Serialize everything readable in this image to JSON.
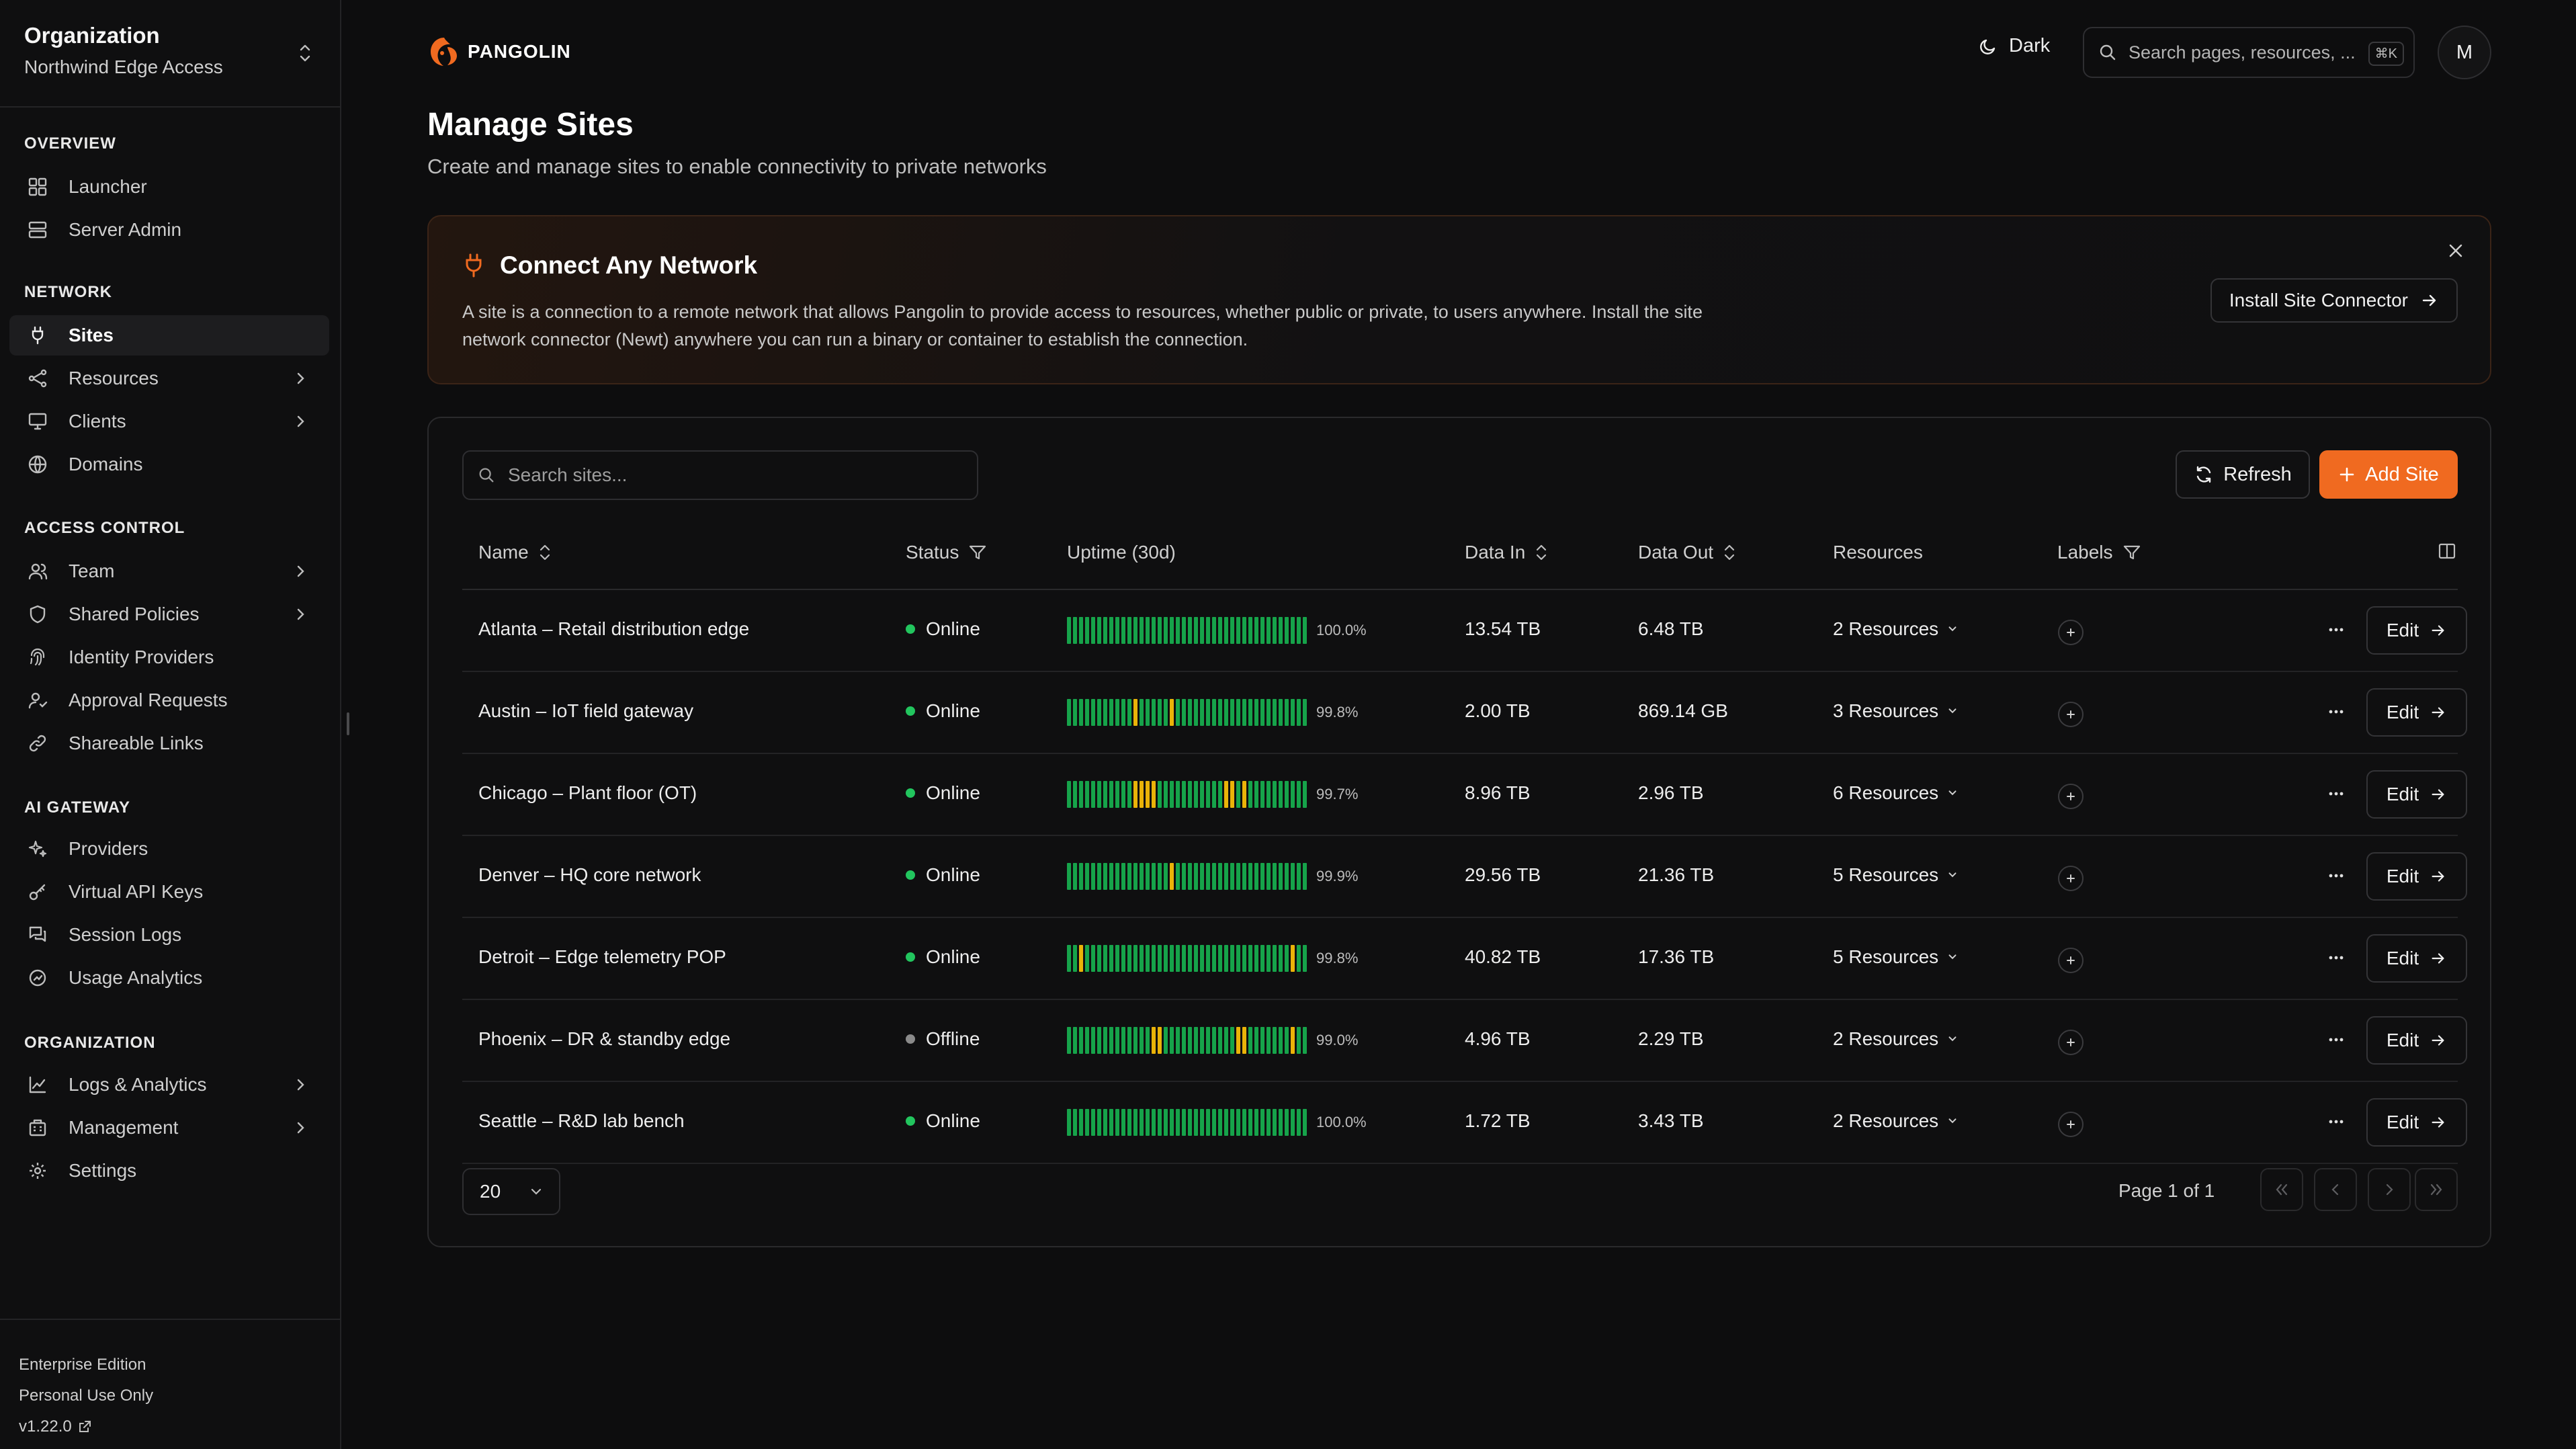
{
  "sidebar": {
    "org_title": "Organization",
    "org_name": "Northwind Edge Access",
    "sections": {
      "overview": "OVERVIEW",
      "network": "NETWORK",
      "access": "ACCESS CONTROL",
      "ai": "AI GATEWAY",
      "organization": "ORGANIZATION"
    },
    "items": {
      "launcher": "Launcher",
      "server_admin": "Server Admin",
      "sites": "Sites",
      "resources": "Resources",
      "clients": "Clients",
      "domains": "Domains",
      "team": "Team",
      "shared_policies": "Shared Policies",
      "identity_providers": "Identity Providers",
      "approval_requests": "Approval Requests",
      "shareable_links": "Shareable Links",
      "providers": "Providers",
      "virtual_api_keys": "Virtual API Keys",
      "session_logs": "Session Logs",
      "usage_analytics": "Usage Analytics",
      "logs_analytics": "Logs & Analytics",
      "management": "Management",
      "settings": "Settings"
    },
    "footer": {
      "edition": "Enterprise Edition",
      "license": "Personal Use Only",
      "version": "v1.22.0"
    }
  },
  "header": {
    "brand": "PANGOLIN",
    "theme_label": "Dark",
    "search_placeholder": "Search pages, resources, ...",
    "search_shortcut": "⌘K",
    "avatar_initial": "M"
  },
  "page": {
    "title": "Manage Sites",
    "subtitle": "Create and manage sites to enable connectivity to private networks"
  },
  "banner": {
    "title": "Connect Any Network",
    "body": "A site is a connection to a remote network that allows Pangolin to provide access to resources, whether public or private, to users anywhere. Install the site network connector (Newt) anywhere you can run a binary or container to establish the connection.",
    "button_label": "Install Site Connector"
  },
  "toolbar": {
    "search_placeholder": "Search sites...",
    "refresh_label": "Refresh",
    "add_label": "Add Site"
  },
  "table": {
    "columns": {
      "name": "Name",
      "status": "Status",
      "uptime": "Uptime (30d)",
      "data_in": "Data In",
      "data_out": "Data Out",
      "resources": "Resources",
      "labels": "Labels"
    },
    "edit_label": "Edit",
    "rows": [
      {
        "name": "Atlanta – Retail distribution edge",
        "status": "Online",
        "uptime": "100.0%",
        "data_in": "13.54 TB",
        "data_out": "6.48 TB",
        "resources": "2 Resources"
      },
      {
        "name": "Austin – IoT field gateway",
        "status": "Online",
        "uptime": "99.8%",
        "data_in": "2.00 TB",
        "data_out": "869.14 GB",
        "resources": "3 Resources"
      },
      {
        "name": "Chicago – Plant floor (OT)",
        "status": "Online",
        "uptime": "99.7%",
        "data_in": "8.96 TB",
        "data_out": "2.96 TB",
        "resources": "6 Resources"
      },
      {
        "name": "Denver – HQ core network",
        "status": "Online",
        "uptime": "99.9%",
        "data_in": "29.56 TB",
        "data_out": "21.36 TB",
        "resources": "5 Resources"
      },
      {
        "name": "Detroit – Edge telemetry POP",
        "status": "Online",
        "uptime": "99.8%",
        "data_in": "40.82 TB",
        "data_out": "17.36 TB",
        "resources": "5 Resources"
      },
      {
        "name": "Phoenix – DR & standby edge",
        "status": "Offline",
        "uptime": "99.0%",
        "data_in": "4.96 TB",
        "data_out": "2.29 TB",
        "resources": "2 Resources"
      },
      {
        "name": "Seattle – R&D lab bench",
        "status": "Online",
        "uptime": "100.0%",
        "data_in": "1.72 TB",
        "data_out": "3.43 TB",
        "resources": "2 Resources"
      }
    ],
    "uptime_days": [
      [],
      [
        11,
        17
      ],
      [
        11,
        12,
        13,
        14,
        26,
        27,
        29
      ],
      [
        17
      ],
      [
        2,
        37
      ],
      [
        14,
        15,
        28,
        29,
        37
      ],
      []
    ]
  },
  "pagination": {
    "page_size": "20",
    "page_info": "Page 1 of 1"
  },
  "colors": {
    "accent": "#f06a20",
    "online": "#22c55e",
    "offline": "#8a8a8a",
    "uptime_ok": "#16a34a",
    "uptime_degraded": "#eab308"
  }
}
